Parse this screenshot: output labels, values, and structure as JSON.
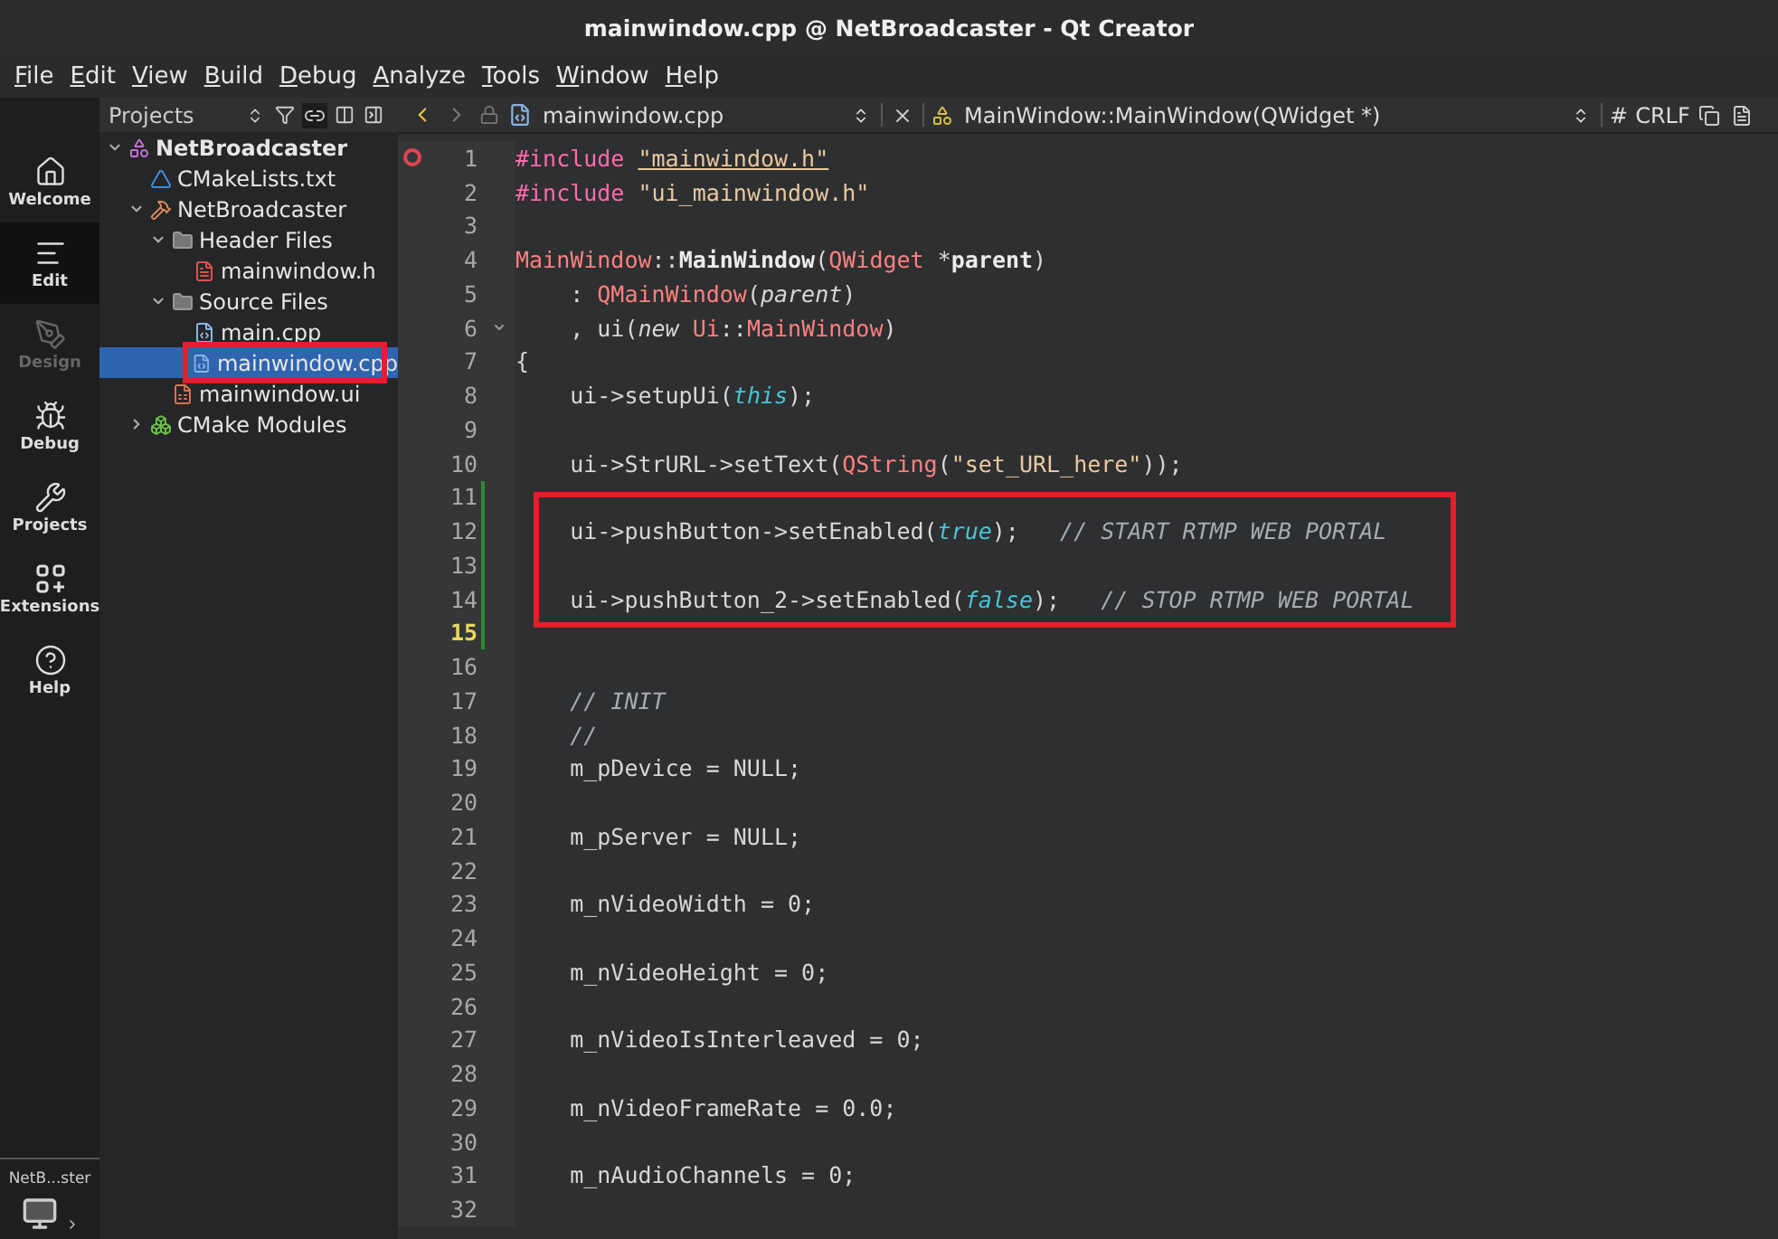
{
  "window": {
    "title": "mainwindow.cpp @ NetBroadcaster - Qt Creator"
  },
  "menu": [
    "File",
    "Edit",
    "View",
    "Build",
    "Debug",
    "Analyze",
    "Tools",
    "Window",
    "Help"
  ],
  "modes": [
    {
      "label": "Welcome",
      "kind": "welcome",
      "selected": false
    },
    {
      "label": "Edit",
      "kind": "edit",
      "selected": true
    },
    {
      "label": "Design",
      "kind": "design",
      "selected": false,
      "disabled": true
    },
    {
      "label": "Debug",
      "kind": "debug",
      "selected": false
    },
    {
      "label": "Projects",
      "kind": "projects",
      "selected": false
    },
    {
      "label": "Extensions",
      "kind": "extensions",
      "selected": false
    },
    {
      "label": "Help",
      "kind": "help",
      "selected": false
    }
  ],
  "kit": {
    "label": "NetB...ster"
  },
  "projects_panel": {
    "title": "Projects",
    "tree": [
      {
        "label": "NetBroadcaster",
        "kind": "project",
        "expanded": true,
        "selected": false,
        "children": [
          {
            "label": "CMakeLists.txt",
            "kind": "cmake",
            "selected": false
          },
          {
            "label": "NetBroadcaster",
            "kind": "target",
            "expanded": true,
            "selected": false,
            "children": [
              {
                "label": "Header Files",
                "kind": "folder",
                "expanded": true,
                "selected": false,
                "children": [
                  {
                    "label": "mainwindow.h",
                    "kind": "header",
                    "selected": false
                  }
                ]
              },
              {
                "label": "Source Files",
                "kind": "folder",
                "expanded": true,
                "selected": false,
                "children": [
                  {
                    "label": "main.cpp",
                    "kind": "source",
                    "selected": false
                  },
                  {
                    "label": "mainwindow.cpp",
                    "kind": "source",
                    "selected": true,
                    "annotated": true
                  }
                ]
              },
              {
                "label": "mainwindow.ui",
                "kind": "form",
                "selected": false
              }
            ]
          },
          {
            "label": "CMake Modules",
            "kind": "modules",
            "expanded": false,
            "selected": false
          }
        ]
      }
    ]
  },
  "editor": {
    "file": "mainwindow.cpp",
    "symbol": "MainWindow::MainWindow(QWidget *)",
    "hash": "#",
    "line_ending": "CRLF",
    "lines": [
      {
        "number": "1",
        "breakpoint": true,
        "tokens": [
          {
            "text": "#include ",
            "kind": "preproc"
          },
          {
            "text": "\"mainwindow.h\"",
            "kind": "link"
          }
        ]
      },
      {
        "number": "2",
        "tokens": [
          {
            "text": "#include ",
            "kind": "preproc"
          },
          {
            "text": "\"ui_mainwindow.h\"",
            "kind": "string"
          }
        ]
      },
      {
        "number": "3"
      },
      {
        "number": "4",
        "tokens": [
          {
            "text": "MainWindow",
            "kind": "type"
          },
          {
            "text": "::",
            "kind": "plain"
          },
          {
            "text": "MainWindow",
            "kind": "decl"
          },
          {
            "text": "(",
            "kind": "plain"
          },
          {
            "text": "QWidget",
            "kind": "type"
          },
          {
            "text": " *",
            "kind": "plain"
          },
          {
            "text": "parent",
            "kind": "decl"
          },
          {
            "text": ")",
            "kind": "plain"
          }
        ]
      },
      {
        "number": "5",
        "tokens": [
          {
            "text": "    : ",
            "kind": "plain"
          },
          {
            "text": "QMainWindow",
            "kind": "type"
          },
          {
            "text": "(",
            "kind": "plain"
          },
          {
            "text": "parent",
            "kind": "param"
          },
          {
            "text": ")",
            "kind": "plain"
          }
        ]
      },
      {
        "number": "6",
        "foldable": true,
        "tokens": [
          {
            "text": "    , ui(",
            "kind": "plain"
          },
          {
            "text": "new ",
            "kind": "param"
          },
          {
            "text": "Ui",
            "kind": "type"
          },
          {
            "text": "::",
            "kind": "plain"
          },
          {
            "text": "MainWindow",
            "kind": "type"
          },
          {
            "text": ")",
            "kind": "plain"
          }
        ]
      },
      {
        "number": "7",
        "tokens": [
          {
            "text": "{",
            "kind": "plain"
          }
        ]
      },
      {
        "number": "8",
        "tokens": [
          {
            "text": "    ui->setupUi(",
            "kind": "plain"
          },
          {
            "text": "this",
            "kind": "keyword"
          },
          {
            "text": ");",
            "kind": "plain"
          }
        ]
      },
      {
        "number": "9"
      },
      {
        "number": "10",
        "tokens": [
          {
            "text": "    ui->StrURL->setText(",
            "kind": "plain"
          },
          {
            "text": "QString",
            "kind": "type"
          },
          {
            "text": "(",
            "kind": "plain"
          },
          {
            "text": "\"set_URL_here\"",
            "kind": "string"
          },
          {
            "text": "));",
            "kind": "plain"
          }
        ]
      },
      {
        "number": "11",
        "changed": true
      },
      {
        "number": "12",
        "changed": true,
        "annotated": true,
        "tokens": [
          {
            "text": "    ui->pushButton->setEnabled(",
            "kind": "plain"
          },
          {
            "text": "true",
            "kind": "keyword"
          },
          {
            "text": ");   ",
            "kind": "plain"
          },
          {
            "text": "// START RTMP WEB PORTAL",
            "kind": "comment"
          }
        ]
      },
      {
        "number": "13",
        "changed": true,
        "annotated": true
      },
      {
        "number": "14",
        "changed": true,
        "annotated": true,
        "tokens": [
          {
            "text": "    ui->pushButton_2->setEnabled(",
            "kind": "plain"
          },
          {
            "text": "false",
            "kind": "keyword"
          },
          {
            "text": ");   ",
            "kind": "plain"
          },
          {
            "text": "// STOP RTMP WEB PORTAL",
            "kind": "comment"
          }
        ]
      },
      {
        "number": "15",
        "changed": true,
        "current": true
      },
      {
        "number": "16"
      },
      {
        "number": "17",
        "tokens": [
          {
            "text": "    // INIT",
            "kind": "comment"
          }
        ]
      },
      {
        "number": "18",
        "tokens": [
          {
            "text": "    //",
            "kind": "comment"
          }
        ]
      },
      {
        "number": "19",
        "tokens": [
          {
            "text": "    m_pDevice = NULL;",
            "kind": "plain"
          }
        ]
      },
      {
        "number": "20"
      },
      {
        "number": "21",
        "tokens": [
          {
            "text": "    m_pServer = NULL;",
            "kind": "plain"
          }
        ]
      },
      {
        "number": "22"
      },
      {
        "number": "23",
        "tokens": [
          {
            "text": "    m_nVideoWidth = 0;",
            "kind": "plain"
          }
        ]
      },
      {
        "number": "24"
      },
      {
        "number": "25",
        "tokens": [
          {
            "text": "    m_nVideoHeight = 0;",
            "kind": "plain"
          }
        ]
      },
      {
        "number": "26"
      },
      {
        "number": "27",
        "tokens": [
          {
            "text": "    m_nVideoIsInterleaved = 0;",
            "kind": "plain"
          }
        ]
      },
      {
        "number": "28"
      },
      {
        "number": "29",
        "tokens": [
          {
            "text": "    m_nVideoFrameRate = 0.0;",
            "kind": "plain"
          }
        ]
      },
      {
        "number": "30"
      },
      {
        "number": "31",
        "tokens": [
          {
            "text": "    m_nAudioChannels = 0;",
            "kind": "plain"
          }
        ]
      },
      {
        "number": "32"
      }
    ]
  }
}
